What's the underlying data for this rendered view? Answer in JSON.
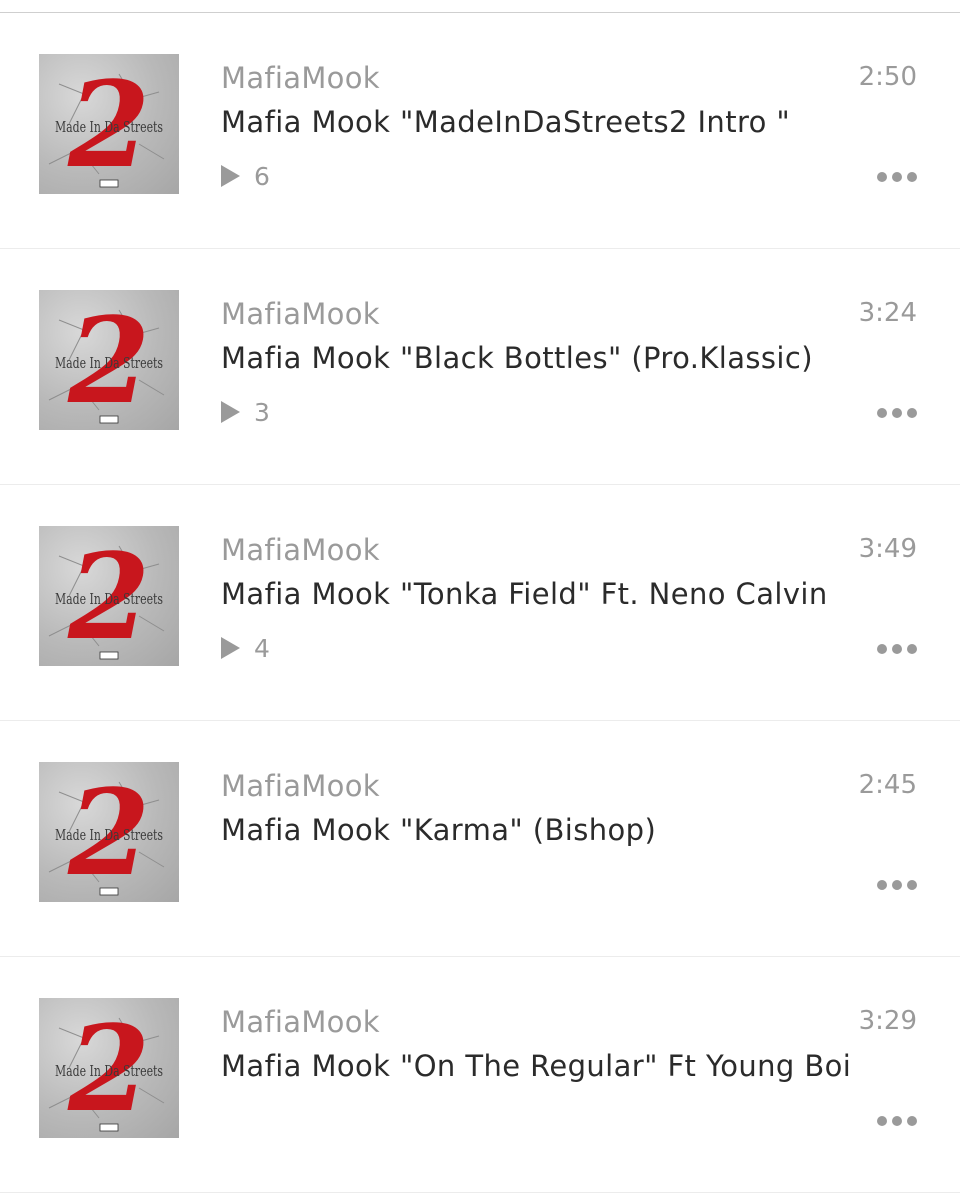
{
  "tracks": [
    {
      "uploader": "MafiaMook",
      "title": "Mafia Mook \"MadeInDaStreets2 Intro \"",
      "duration": "2:50",
      "plays": "6",
      "artwork_text": "Made In Da Streets",
      "artwork_number": "2"
    },
    {
      "uploader": "MafiaMook",
      "title": "Mafia Mook \"Black Bottles\" (Pro.Klassic)",
      "duration": "3:24",
      "plays": "3",
      "artwork_text": "Made In Da Streets",
      "artwork_number": "2"
    },
    {
      "uploader": "MafiaMook",
      "title": "Mafia Mook \"Tonka Field\" Ft. Neno Calvin",
      "duration": "3:49",
      "plays": "4",
      "artwork_text": "Made In Da Streets",
      "artwork_number": "2"
    },
    {
      "uploader": "MafiaMook",
      "title": "Mafia Mook \"Karma\" (Bishop)",
      "duration": "2:45",
      "plays": "",
      "artwork_text": "Made In Da Streets",
      "artwork_number": "2"
    },
    {
      "uploader": "MafiaMook",
      "title": "Mafia Mook \"On The Regular\" Ft Young Boi",
      "duration": "3:29",
      "plays": "",
      "artwork_text": "Made In Da Streets",
      "artwork_number": "2"
    }
  ],
  "icons": {
    "play": "play-icon",
    "more": "more-options-icon"
  },
  "colors": {
    "muted_text": "#9a9a9a",
    "title_text": "#2b2b2b",
    "artwork_red": "#c8161d"
  }
}
